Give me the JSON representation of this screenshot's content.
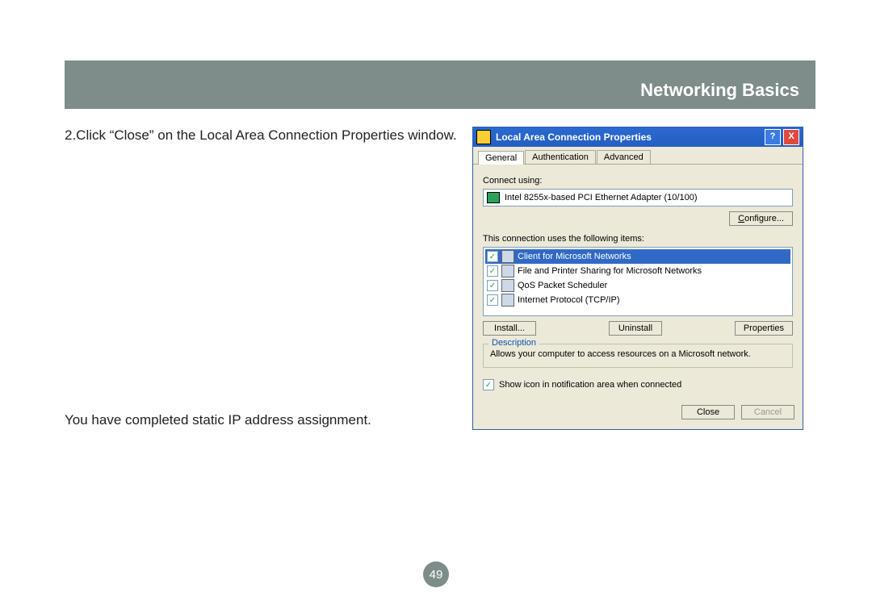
{
  "header": {
    "title": "Networking Basics"
  },
  "instructions": {
    "step": "2.Click “Close” on the Local Area Connection Properties window.",
    "completed": "You have completed static IP address assignment."
  },
  "page_number": "49",
  "dialog": {
    "title": "Local Area Connection Properties",
    "tabs": [
      "General",
      "Authentication",
      "Advanced"
    ],
    "connect_using_label": "Connect using:",
    "adapter": "Intel 8255x-based PCI Ethernet Adapter (10/100)",
    "configure_label": "Configure...",
    "items_label": "This connection uses the following items:",
    "items": [
      {
        "label": "Client for Microsoft Networks",
        "selected": true
      },
      {
        "label": "File and Printer Sharing for Microsoft Networks",
        "selected": false
      },
      {
        "label": "QoS Packet Scheduler",
        "selected": false
      },
      {
        "label": "Internet Protocol (TCP/IP)",
        "selected": false
      }
    ],
    "buttons": {
      "install": "Install...",
      "uninstall": "Uninstall",
      "properties": "Properties"
    },
    "description": {
      "legend": "Description",
      "text": "Allows your computer to access resources on a Microsoft network."
    },
    "show_icon": "Show icon in notification area when connected",
    "footer": {
      "close": "Close",
      "cancel": "Cancel"
    }
  }
}
